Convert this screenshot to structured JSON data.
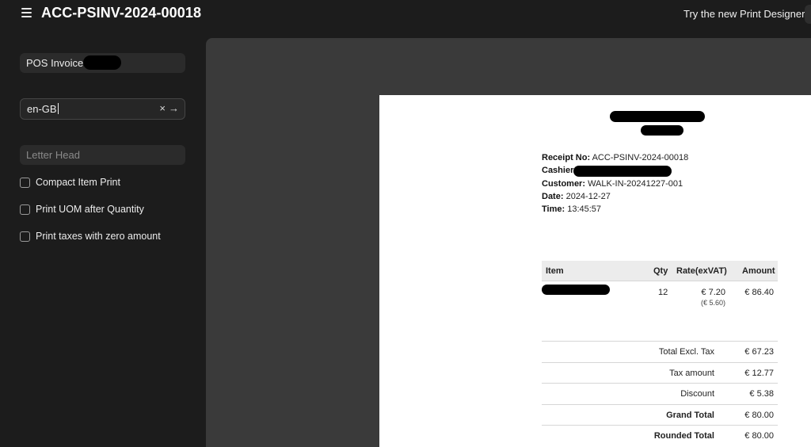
{
  "header": {
    "title": "ACC-PSINV-2024-00018",
    "designer_link": "Try the new Print Designer"
  },
  "sidebar": {
    "doctype_value": "POS Invoice",
    "language_value": "en-GB",
    "clear_icon": "×",
    "go_icon": "→",
    "letterhead_placeholder": "Letter Head",
    "options": [
      {
        "label": "Compact Item Print",
        "checked": false
      },
      {
        "label": "Print UOM after Quantity",
        "checked": false
      },
      {
        "label": "Print taxes with zero amount",
        "checked": false
      }
    ]
  },
  "receipt": {
    "receipt_no_label": "Receipt No:",
    "receipt_no": "ACC-PSINV-2024-00018",
    "cashier_label": "Cashier:",
    "customer_label": "Customer:",
    "customer": "WALK-IN-20241227-001",
    "date_label": "Date:",
    "date": "2024-12-27",
    "time_label": "Time:",
    "time": "13:45:57",
    "columns": {
      "item": "Item",
      "qty": "Qty",
      "rate": "Rate(exVAT)",
      "amount": "Amount"
    },
    "rows": [
      {
        "qty": "12",
        "rate": "€ 7.20",
        "rate_sub": "(€ 5.60)",
        "amount": "€ 86.40"
      }
    ],
    "totals": [
      {
        "label": "Total Excl. Tax",
        "value": "€ 67.23",
        "bold": false
      },
      {
        "label": "Tax amount",
        "value": "€ 12.77",
        "bold": false
      },
      {
        "label": "Discount",
        "value": "€ 5.38",
        "bold": false
      },
      {
        "label": "Grand Total",
        "value": "€ 80.00",
        "bold": true
      },
      {
        "label": "Rounded Total",
        "value": "€ 80.00",
        "bold": true
      }
    ]
  },
  "colors": {
    "background": "#1c1c1c",
    "preview": "#3a3a3a",
    "paper": "#ffffff"
  }
}
